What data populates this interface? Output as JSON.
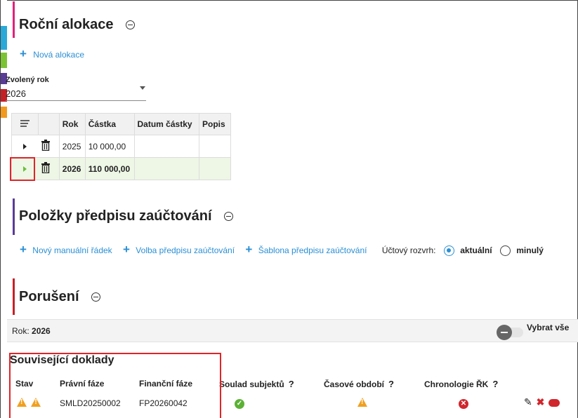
{
  "colors": {
    "accent_blue": "#2a8fd4",
    "strip_cyan": "#29a9d8",
    "strip_green": "#7cc334",
    "strip_purple": "#5a3b96",
    "strip_red": "#c42127",
    "strip_orange": "#f29a1e",
    "section_pink": "#e0217a",
    "section_purple": "#5a3b96",
    "section_red": "#c42127",
    "highlight_red": "#e0242a",
    "selected_row": "#eef7e6"
  },
  "rocni_alokace": {
    "title": "Roční alokace",
    "add_link": "Nová alokace",
    "year_label": "Zvolený rok",
    "year_value": "2026",
    "table": {
      "columns": [
        "Rok",
        "Částka",
        "Datum částky",
        "Popis"
      ],
      "rows": [
        {
          "rok": "2025",
          "castka": "10 000,00",
          "datum": "",
          "popis": ""
        },
        {
          "rok": "2026",
          "castka": "110 000,00",
          "datum": "",
          "popis": ""
        }
      ]
    }
  },
  "polozky": {
    "title": "Položky předpisu zaúčtování",
    "link1": "Nový manuální řádek",
    "link2": "Volba předpisu zaúčtování",
    "link3": "Šablona předpisu zaúčtování",
    "rozvrh_label": "Účtový rozvrh:",
    "opt1": "aktuální",
    "opt2": "minulý"
  },
  "poruseni": {
    "title": "Porušení",
    "rok_label": "Rok:",
    "rok_value": "2026",
    "select_all": "Vybrat vše"
  },
  "souvisejici": {
    "title": "Související doklady",
    "columns": {
      "stav": "Stav",
      "pravni": "Právní fáze",
      "financni": "Finanční fáze",
      "soulad": "Soulad subjektů",
      "casove": "Časové období",
      "chronologie": "Chronologie ŘK",
      "q": "?"
    },
    "row": {
      "pravni": "SMLD20250002",
      "financni": "FP20260042"
    }
  },
  "icons": {
    "collapse": "minus-circle-icon",
    "plus": "plus-icon",
    "trash": "trash-icon",
    "expand": "expand-triangle-icon",
    "warning": "warning-icon",
    "ok": "check-circle-icon",
    "error": "x-circle-icon",
    "edit": "pencil-icon",
    "delete": "x-icon",
    "comment": "comment-icon"
  }
}
